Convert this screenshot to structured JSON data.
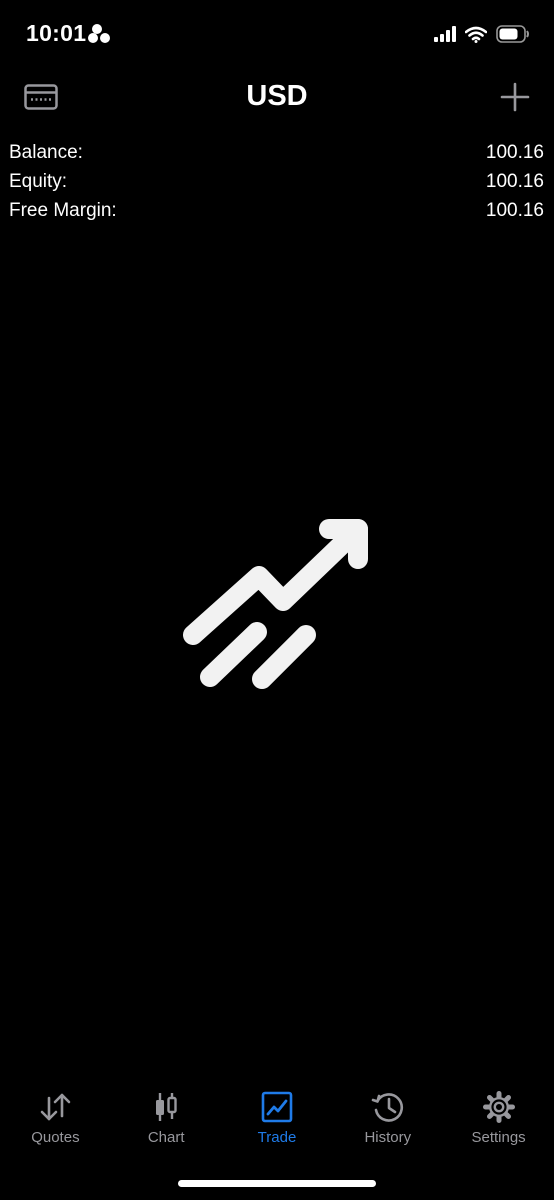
{
  "status_bar": {
    "time": "10:01"
  },
  "header": {
    "title": "USD",
    "left_icon": "wallet-card-icon",
    "right_icon": "plus-icon"
  },
  "account": {
    "rows": [
      {
        "label": "Balance:",
        "value": "100.16"
      },
      {
        "label": "Equity:",
        "value": "100.16"
      },
      {
        "label": "Free Margin:",
        "value": "100.16"
      }
    ]
  },
  "empty_state_icon": "trend-up-icon",
  "tabs": [
    {
      "label": "Quotes",
      "icon": "quotes-arrows-icon",
      "active": false
    },
    {
      "label": "Chart",
      "icon": "candlestick-icon",
      "active": false
    },
    {
      "label": "Trade",
      "icon": "trade-chart-icon",
      "active": true
    },
    {
      "label": "History",
      "icon": "history-clock-icon",
      "active": false
    },
    {
      "label": "Settings",
      "icon": "gear-icon",
      "active": false
    }
  ],
  "colors": {
    "background": "#000000",
    "text": "#ffffff",
    "tab_inactive": "#98989d",
    "tab_active": "#1f7be8"
  }
}
